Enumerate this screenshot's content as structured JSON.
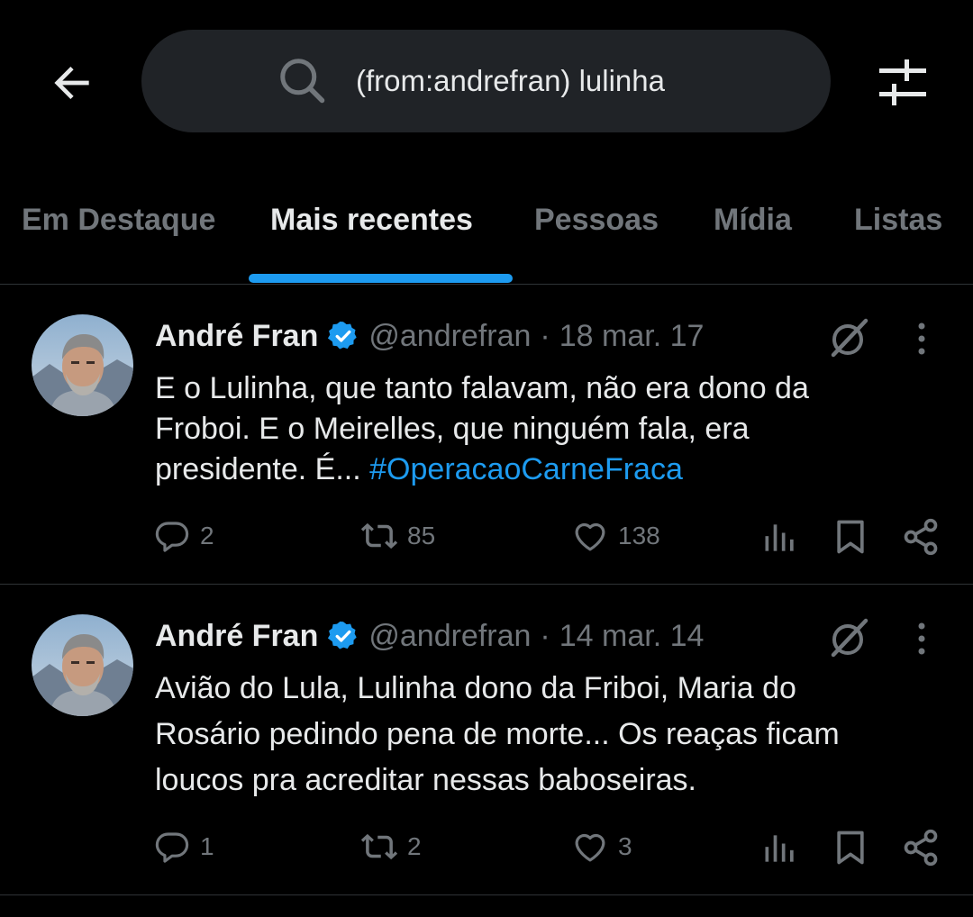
{
  "search": {
    "query": "(from:andrefran) lulinha"
  },
  "tabs": [
    {
      "label": "Em Destaque"
    },
    {
      "label": "Mais recentes"
    },
    {
      "label": "Pessoas"
    },
    {
      "label": "Mídia"
    },
    {
      "label": "Listas"
    }
  ],
  "posts": [
    {
      "author": "André Fran",
      "handle": "@andrefran",
      "separator": "·",
      "date": "18 mar. 17",
      "text_lines": [
        "E o Lulinha, que tanto falavam, não era dono da",
        "Froboi. E o Meirelles, que ninguém fala, era",
        "presidente. É..."
      ],
      "hashtag": "#OperacaoCarneFraca",
      "replies": "2",
      "reposts": "85",
      "likes": "138"
    },
    {
      "author": "André Fran",
      "handle": "@andrefran",
      "separator": "·",
      "date": "14 mar. 14",
      "text_lines": [
        "Avião do Lula, Lulinha dono da Friboi, Maria do",
        "Rosário pedindo pena de morte... Os reaças ficam",
        "loucos pra acreditar nessas baboseiras."
      ],
      "replies": "1",
      "reposts": "2",
      "likes": "3"
    }
  ],
  "colors": {
    "background": "#000000",
    "accent": "#1d9bf0",
    "muted_text": "#71767b",
    "primary_text": "#e7e9ea",
    "search_bg": "#202327",
    "divider": "#2f3336"
  },
  "icons": [
    "back-arrow-icon",
    "search-icon",
    "filter-sliders-icon",
    "verified-badge-icon",
    "grok-icon",
    "more-vertical-icon",
    "reply-icon",
    "repost-icon",
    "like-icon",
    "views-icon",
    "bookmark-icon",
    "share-icon"
  ]
}
